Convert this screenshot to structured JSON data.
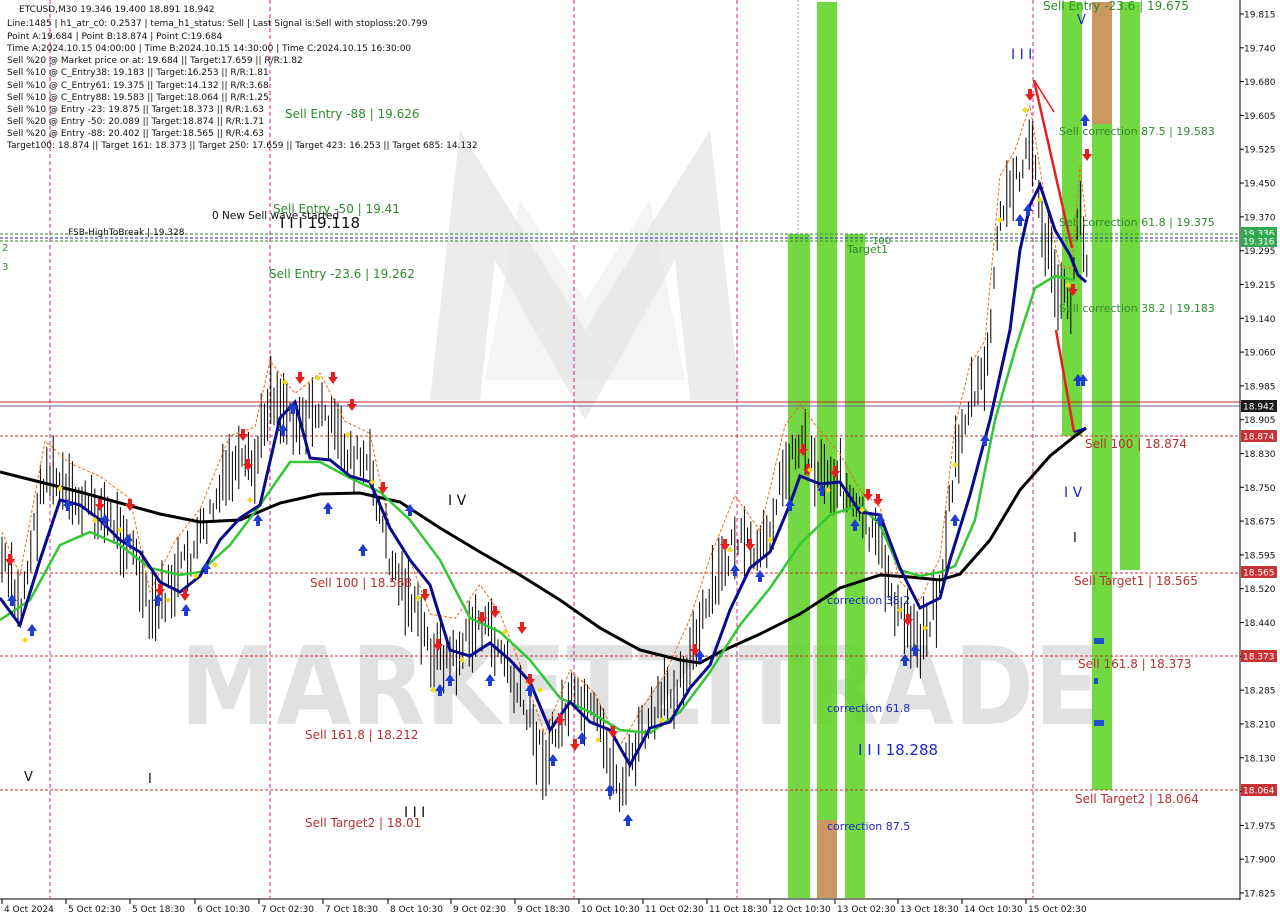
{
  "info_panel": [
    "ETCUSD,M30  19.346 19.400 18.891 18.942",
    "Line:1485 | h1_atr_c0: 0.2537 | tema_h1_status: Sell | Last Signal is:Sell with stoploss:20.799",
    "Point A:19.684 | Point B:18.874 | Point C:19.684",
    "Time A:2024.10.15 04:00:00 | Time B:2024.10.15 14:30:00 | Time C:2024.10.15 16:30:00",
    "Sell %20 @ Market price or at: 19.684 || Target:17.659 || R/R:1.82",
    "Sell %10 @ C_Entry38: 19.183 || Target:16.253 || R/R:1.81",
    "Sell %10 @ C_Entry61: 19.375 || Target:14.132 || R/R:3.68",
    "Sell %10 @ C_Entry88: 19.583 || Target:18.064 || R/R:1.25",
    "Sell %10 @ Entry -23: 19.875 || Target:18.373 || R/R:1.63",
    "Sell %20 @ Entry -50: 20.089 || Target:18.874 || R/R:1.71",
    "Sell %20 @ Entry -88: 20.402 || Target:18.565 || R/R:4.63",
    "Target100: 18.874 || Target 161: 18.373 || Target 250: 17.659 || Target 423: 16.253 || Target 685: 14.132"
  ],
  "watermark": "MARKETZITRADE",
  "chart_data": {
    "type": "candlestick",
    "symbol": "ETCUSD",
    "timeframe": "M30",
    "ohlc_last": {
      "open": 19.346,
      "high": 19.4,
      "low": 18.891,
      "close": 18.942
    },
    "ylim": [
      17.825,
      19.85
    ],
    "price_ticks": [
      "19.815",
      "19.740",
      "19.680",
      "19.605",
      "19.525",
      "19.450",
      "19.370",
      "19.295",
      "19.215",
      "19.140",
      "19.060",
      "18.985",
      "18.905",
      "18.830",
      "18.750",
      "18.675",
      "18.595",
      "18.520",
      "18.440",
      "18.365",
      "18.285",
      "18.210",
      "18.130",
      "18.055",
      "17.975",
      "17.900",
      "17.825"
    ],
    "time_labels": [
      "4 Oct 2024",
      "5 Oct 02:30",
      "5 Oct 18:30",
      "6 Oct 10:30",
      "7 Oct 02:30",
      "7 Oct 18:30",
      "8 Oct 10:30",
      "9 Oct 02:30",
      "9 Oct 18:30",
      "10 Oct 10:30",
      "11 Oct 02:30",
      "11 Oct 18:30",
      "12 Oct 10:30",
      "13 Oct 02:30",
      "13 Oct 18:30",
      "14 Oct 10:30",
      "15 Oct 02:30"
    ],
    "price_boxes": [
      {
        "value": "19.336",
        "color": "#32a852"
      },
      {
        "value": "19.316",
        "color": "#32a852"
      },
      {
        "value": "18.942",
        "color": "#1c1c1c"
      },
      {
        "value": "18.874",
        "color": "#c83232"
      },
      {
        "value": "18.565",
        "color": "#c83232"
      },
      {
        "value": "18.373",
        "color": "#c83232"
      },
      {
        "value": "18.064",
        "color": "#c83232"
      }
    ],
    "annotations": [
      "Sell Entry -88 | 19.626",
      "0 New Sell wave started",
      "Sell Entry -50 | 19.41",
      "I I I 19.118",
      "FSB-HighToBreak | 19.328",
      "Sell Entry -23.6 | 19.262",
      "Sell 100 | 18.568",
      "Sell 161.8 | 18.212",
      "Sell Target2 | 18.01",
      "Sell Entry -23.6 | 19.675",
      "Sell correction 87.5 | 19.583",
      "Sell correction 61.8 | 19.375",
      "Sell correction 38.2 | 19.183",
      "Sell 100 | 18.874",
      "Sell Target1 | 18.565",
      "Sell 161.8 | 18.373",
      "Sell Target2 | 18.064",
      "correction 38.2",
      "correction 61.8",
      "correction 87.5",
      "I I I 18.288",
      "Target1",
      "100",
      "I V",
      "I I I",
      "V",
      "I",
      "2",
      "3"
    ],
    "colors": {
      "background": "#ffffff",
      "ma_black": "#000000",
      "ma_blue": "#0a0a8c",
      "ma_green": "#32c832",
      "sell_label": "#b43232",
      "buy_label": "#2d8c2d",
      "correction_label": "#1e28c8",
      "zone_green": "#5ad21e",
      "zone_brown": "#c88c50",
      "bar": "#000000"
    }
  }
}
